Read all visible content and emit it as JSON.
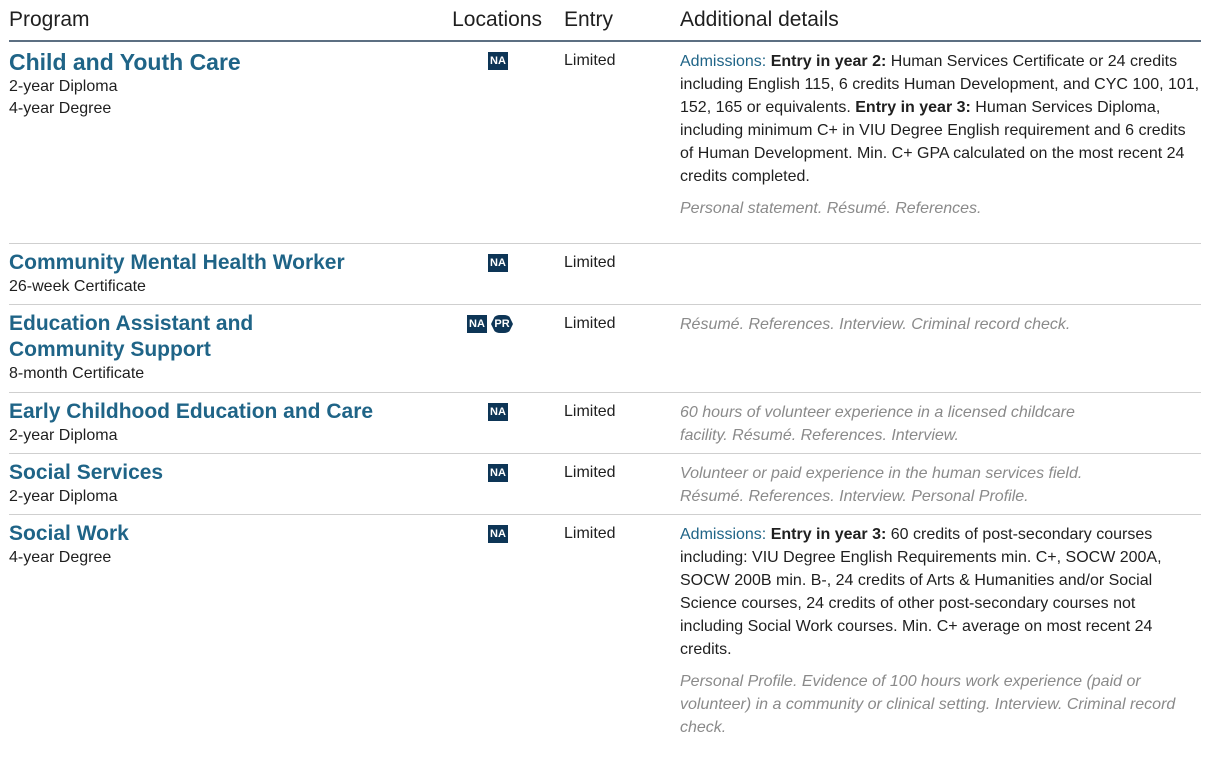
{
  "header": {
    "program": "Program",
    "locations": "Locations",
    "entry": "Entry",
    "details": "Additional details"
  },
  "rows": [
    {
      "name": "Child and Youth Care",
      "credentials": [
        "2-year Diploma",
        "4-year Degree"
      ],
      "locations": [
        "NA"
      ],
      "entry": "Limited",
      "admissions_label": "Admissions:",
      "adm1_bold": "Entry in year 2:",
      "adm1_text": " Human Services Certificate or 24 credits including English 115, 6 credits Human Development, and CYC 100, 101, 152, 165 or equivalents.",
      "adm2_bold": "Entry in year 3:",
      "adm2_text": " Human Services Diploma, including minimum C+ in VIU Degree English requirement and 6 credits of Human Development. Min. C+ GPA calculated on the most recent 24 credits completed.",
      "note": "Personal statement. Résumé. References."
    },
    {
      "name": "Community Mental Health Worker",
      "credentials": [
        "26-week Certificate"
      ],
      "locations": [
        "NA"
      ],
      "entry": "Limited",
      "note": ""
    },
    {
      "name_line1": "Education Assistant and",
      "name_line2": "Community Support",
      "credentials": [
        "8-month Certificate"
      ],
      "locations": [
        "NA",
        "PR"
      ],
      "entry": "Limited",
      "note": "Résumé. References. Interview. Criminal record check."
    },
    {
      "name": "Early Childhood Education and Care",
      "credentials": [
        "2-year Diploma"
      ],
      "locations": [
        "NA"
      ],
      "entry": "Limited",
      "note_line1": "60 hours of volunteer experience in a licensed childcare",
      "note_line2": "facility. Résumé. References. Interview."
    },
    {
      "name": "Social Services",
      "credentials": [
        "2-year Diploma"
      ],
      "locations": [
        "NA"
      ],
      "entry": "Limited",
      "note_line1": "Volunteer or paid experience in the human services field.",
      "note_line2": "Résumé. References. Interview. Personal Profile."
    },
    {
      "name": "Social Work",
      "credentials": [
        "4-year Degree"
      ],
      "locations": [
        "NA"
      ],
      "entry": "Limited",
      "admissions_label": "Admissions:",
      "adm1_bold": "Entry in year 3:",
      "adm1_text": " 60 credits of post-secondary courses including: VIU Degree English Requirements min. C+, SOCW 200A, SOCW 200B min. B-, 24 credits of Arts & Humanities and/or Social Science courses, 24 credits of other post-secondary courses not including Social Work courses. Min. C+ average on most recent 24 credits.",
      "note": "Personal Profile. Evidence of 100 hours work experience (paid or volunteer) in a community or clinical setting. Interview. Criminal record check."
    }
  ]
}
